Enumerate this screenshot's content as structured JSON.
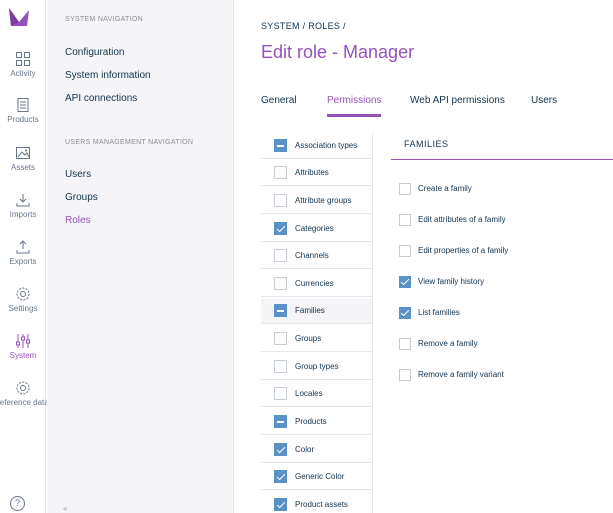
{
  "rail": {
    "items": [
      {
        "label": "Activity",
        "icon": "activity-icon"
      },
      {
        "label": "Products",
        "icon": "products-icon"
      },
      {
        "label": "Assets",
        "icon": "assets-icon"
      },
      {
        "label": "Imports",
        "icon": "imports-icon"
      },
      {
        "label": "Exports",
        "icon": "exports-icon"
      },
      {
        "label": "Settings",
        "icon": "settings-icon"
      },
      {
        "label": "System",
        "icon": "system-icon"
      },
      {
        "label": "Reference data",
        "icon": "reference-data-icon"
      }
    ],
    "help": "?",
    "accent": "#9452ba"
  },
  "subnav": {
    "system_title": "SYSTEM NAVIGATION",
    "system_links": [
      "Configuration",
      "System information",
      "API connections"
    ],
    "users_title": "USERS MANAGEMENT NAVIGATION",
    "users_links": [
      "Users",
      "Groups",
      "Roles"
    ],
    "collapse": "«"
  },
  "breadcrumb": "SYSTEM / ROLES /",
  "page_title": "Edit role - Manager",
  "tabs": [
    "General",
    "Permissions",
    "Web API permissions",
    "Users"
  ],
  "permissions": [
    {
      "label": "Association types",
      "state": "partial"
    },
    {
      "label": "Attributes",
      "state": "unchecked"
    },
    {
      "label": "Attribute groups",
      "state": "unchecked"
    },
    {
      "label": "Categories",
      "state": "checked"
    },
    {
      "label": "Channels",
      "state": "unchecked"
    },
    {
      "label": "Currencies",
      "state": "unchecked"
    },
    {
      "label": "Families",
      "state": "partial"
    },
    {
      "label": "Groups",
      "state": "unchecked"
    },
    {
      "label": "Group types",
      "state": "unchecked"
    },
    {
      "label": "Locales",
      "state": "unchecked"
    },
    {
      "label": "Products",
      "state": "partial"
    },
    {
      "label": "Color",
      "state": "checked"
    },
    {
      "label": "Generic Color",
      "state": "checked"
    },
    {
      "label": "Product assets",
      "state": "checked"
    }
  ],
  "detail": {
    "title": "FAMILIES",
    "acls": [
      {
        "label": "Create a family",
        "checked": false
      },
      {
        "label": "Edit attributes of a family",
        "checked": false
      },
      {
        "label": "Edit properties of a family",
        "checked": false
      },
      {
        "label": "View family history",
        "checked": true
      },
      {
        "label": "List families",
        "checked": true
      },
      {
        "label": "Remove a family",
        "checked": false
      },
      {
        "label": "Remove a family variant",
        "checked": false
      }
    ]
  }
}
